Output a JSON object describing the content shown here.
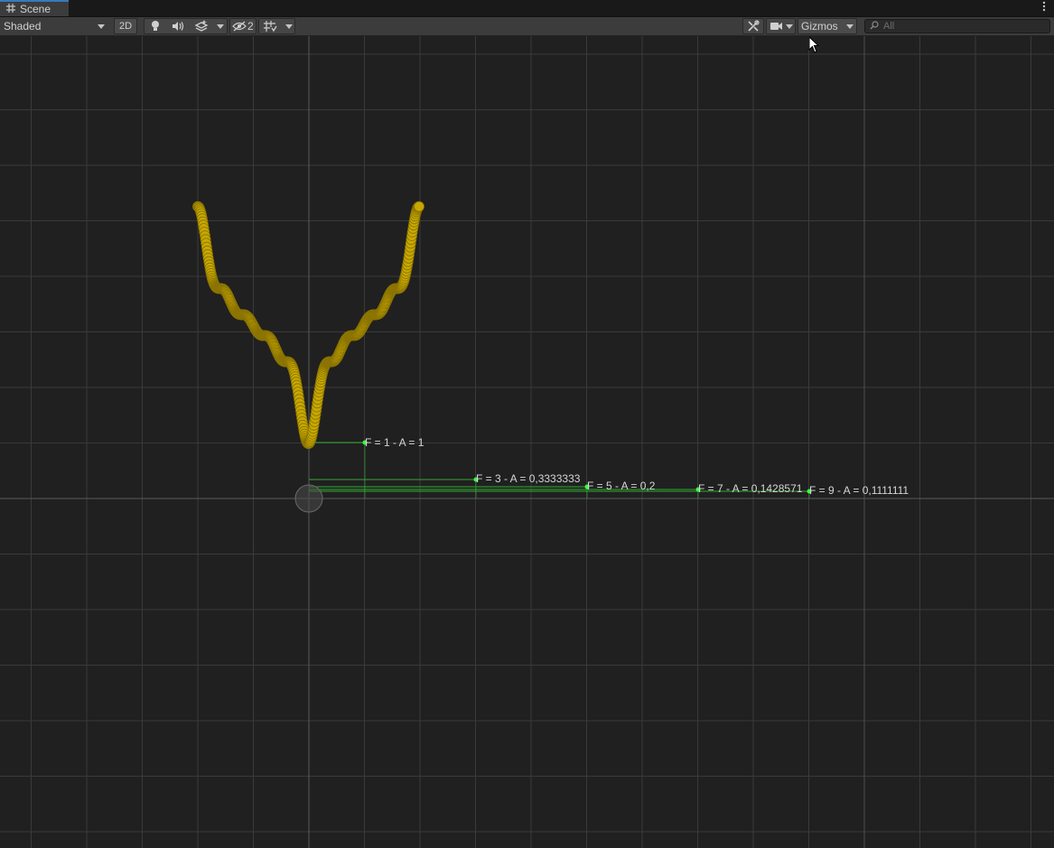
{
  "window": {
    "tab_label": "Scene",
    "tab_icon": "grid-hash-icon",
    "more_icon": "vertical-ellipsis-icon"
  },
  "toolbar": {
    "shading_mode": "Shaded",
    "mode_2d": "2D",
    "hidden_count": "2",
    "gizmos_label": "Gizmos",
    "search_placeholder": "All",
    "icons": [
      "lightbulb-icon",
      "speaker-icon",
      "layers-fx-icon",
      "eye-slash-icon",
      "grid-snap-icon",
      "tools-icon",
      "camera-icon",
      "search-icon"
    ]
  },
  "scene": {
    "colors": {
      "background": "#202020",
      "grid": "#3a3a3a",
      "axis": "#5a5a5a",
      "curve": "#c7a800",
      "gizmo_line": "#2faa2f",
      "gizmo_point": "#3cff3c",
      "label": "#d6d6d6"
    },
    "harmonic_labels": [
      {
        "text": "F = 1 - A = 1"
      },
      {
        "text": "F = 3 - A = 0,3333333"
      },
      {
        "text": "F = 5 - A = 0,2"
      },
      {
        "text": "F = 7 - A = 0,1428571"
      },
      {
        "text": "F = 9 - A = 0,1111111"
      }
    ]
  }
}
